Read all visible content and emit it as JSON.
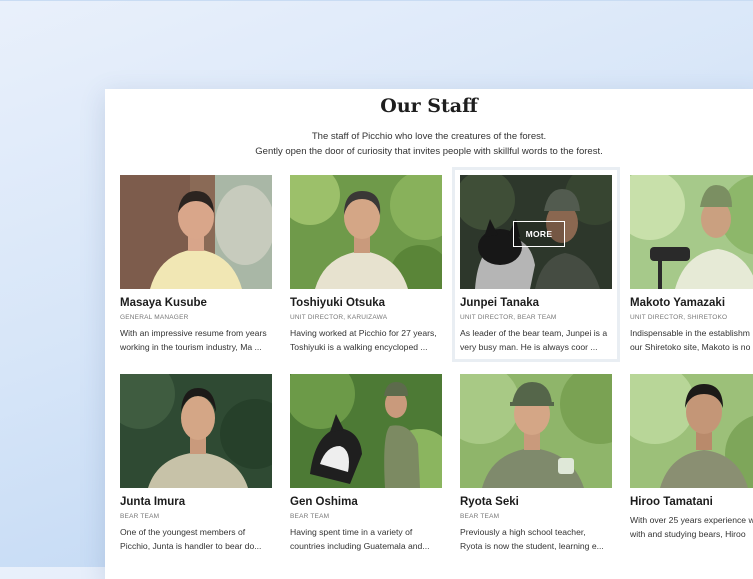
{
  "page": {
    "title": "Our Staff",
    "intro_line1": "The staff of Picchio who love the creatures of the forest.",
    "intro_line2": "Gently open the door of curiosity that invites people with skillful words to the forest.",
    "more_label": "MORE"
  },
  "staff": [
    {
      "name": "Masaya Kusube",
      "role": "GENERAL MANAGER",
      "desc1": "With an impressive resume from years",
      "desc2": "working in the tourism industry, Ma ..."
    },
    {
      "name": "Toshiyuki Otsuka",
      "role": "UNIT DIRECTOR, KARUIZAWA",
      "desc1": "Having worked at Picchio for 27 years,",
      "desc2": "Toshiyuki is a walking encycloped ..."
    },
    {
      "name": "Junpei Tanaka",
      "role": "UNIT DIRECTOR, BEAR TEAM",
      "desc1": "As leader of the bear team, Junpei is a",
      "desc2": "very busy man. He is always coor ..."
    },
    {
      "name": "Makoto Yamazaki",
      "role": "UNIT DIRECTOR, SHIRETOKO",
      "desc1": "Indispensable in the establishm",
      "desc2": "our Shiretoko site, Makoto is no"
    },
    {
      "name": "Junta Imura",
      "role": "BEAR TEAM",
      "desc1": "One of the youngest members of",
      "desc2": "Picchio, Junta is handler to bear do..."
    },
    {
      "name": "Gen Oshima",
      "role": "BEAR TEAM",
      "desc1": "Having spent time in a variety of",
      "desc2": "countries including Guatemala and..."
    },
    {
      "name": "Ryota Seki",
      "role": "BEAR TEAM",
      "desc1": "Previously a high school teacher,",
      "desc2": "Ryota is now the student, learning e..."
    },
    {
      "name": "Hiroo Tamatani",
      "role": "",
      "desc1": "With over 25 years experience w",
      "desc2": "with and studying bears, Hiroo"
    }
  ],
  "colors": {
    "accent": "#1e1e1e",
    "forest": "#4f7a34"
  }
}
